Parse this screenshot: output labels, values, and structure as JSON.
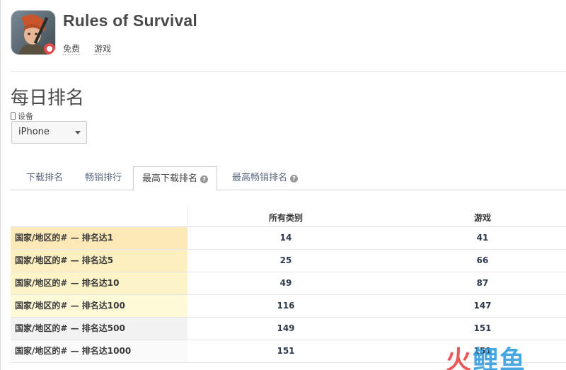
{
  "app": {
    "title": "Rules of Survival",
    "tags": [
      "免费",
      "游戏"
    ]
  },
  "section": {
    "title": "每日排名",
    "device_label": "设备",
    "device_value": "iPhone"
  },
  "tabs": [
    {
      "label": "下载排名",
      "active": false
    },
    {
      "label": "畅销排行",
      "active": false
    },
    {
      "label": "最高下载排名",
      "active": true
    },
    {
      "label": "最高畅销排名",
      "active": false
    }
  ],
  "table": {
    "columns": [
      "所有类别",
      "游戏"
    ],
    "rows": [
      {
        "label": "国家/地区的# — 排名达1",
        "values": [
          "14",
          "41"
        ],
        "color": "#fde8b8"
      },
      {
        "label": "国家/地区的# — 排名达5",
        "values": [
          "25",
          "66"
        ],
        "color": "#fdefc0"
      },
      {
        "label": "国家/地区的# — 排名达10",
        "values": [
          "49",
          "87"
        ],
        "color": "#fdf3c8"
      },
      {
        "label": "国家/地区的# — 排名达100",
        "values": [
          "116",
          "147"
        ],
        "color": "#fefad8"
      },
      {
        "label": "国家/地区的# — 排名达500",
        "values": [
          "149",
          "151"
        ],
        "color": "#f2f2f2"
      },
      {
        "label": "国家/地区的# — 排名达1000",
        "values": [
          "151",
          "151"
        ],
        "color": "#fafafa"
      }
    ]
  },
  "watermark": {
    "part1": "火",
    "part2": "鲤",
    "part3": "鱼"
  }
}
